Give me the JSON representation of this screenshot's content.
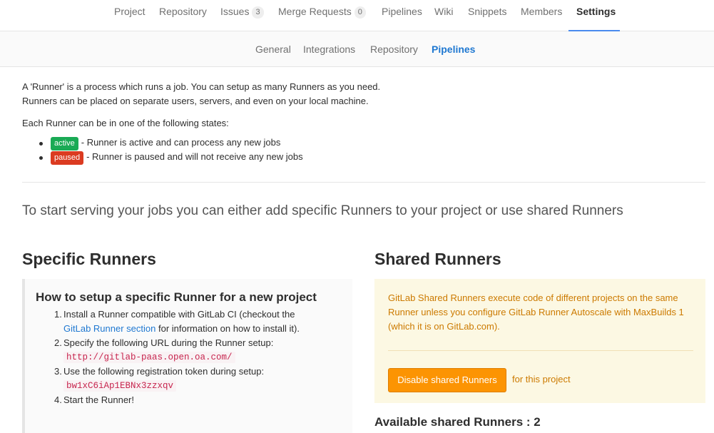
{
  "topnav": {
    "project": "Project",
    "repository": "Repository",
    "issues": "Issues",
    "issues_count": "3",
    "merge_requests": "Merge Requests",
    "merge_requests_count": "0",
    "pipelines": "Pipelines",
    "wiki": "Wiki",
    "snippets": "Snippets",
    "members": "Members",
    "settings": "Settings"
  },
  "subnav": {
    "general": "General",
    "integrations": "Integrations",
    "repository": "Repository",
    "pipelines": "Pipelines"
  },
  "intro": {
    "line1": "A 'Runner' is a process which runs a job. You can setup as many Runners as you need.",
    "line2": "Runners can be placed on separate users, servers, and even on your local machine.",
    "states_heading": "Each Runner can be in one of the following states:",
    "states": [
      {
        "label": "active",
        "text": "- Runner is active and can process any new jobs",
        "color": "#1aaa55"
      },
      {
        "label": "paused",
        "text": "- Runner is paused and will not receive any new jobs",
        "color": "#db3b21"
      }
    ]
  },
  "lead": "To start serving your jobs you can either add specific Runners to your project or use shared Runners",
  "specific": {
    "title": "Specific Runners",
    "setup_title": "How to setup a specific Runner for a new project",
    "step1_a": "Install a Runner compatible with GitLab CI (checkout the",
    "step1_link": "GitLab Runner section",
    "step1_b": "for information on how to install it).",
    "step2": "Specify the following URL during the Runner setup:",
    "url": "http://gitlab-paas.open.oa.com/",
    "step3": "Use the following registration token during setup:",
    "token": "bw1xC6iAp1EBNx3zzxqv",
    "step4": "Start the Runner!",
    "n1": "1.",
    "n2": "2.",
    "n3": "3.",
    "n4": "4."
  },
  "shared": {
    "title": "Shared Runners",
    "description": "GitLab Shared Runners execute code of different projects on the same Runner unless you configure GitLab Runner Autoscale with MaxBuilds 1 (which it is on GitLab.com).",
    "disable_button": "Disable shared Runners",
    "for_project": "for this project",
    "available": "Available shared Runners : 2"
  }
}
